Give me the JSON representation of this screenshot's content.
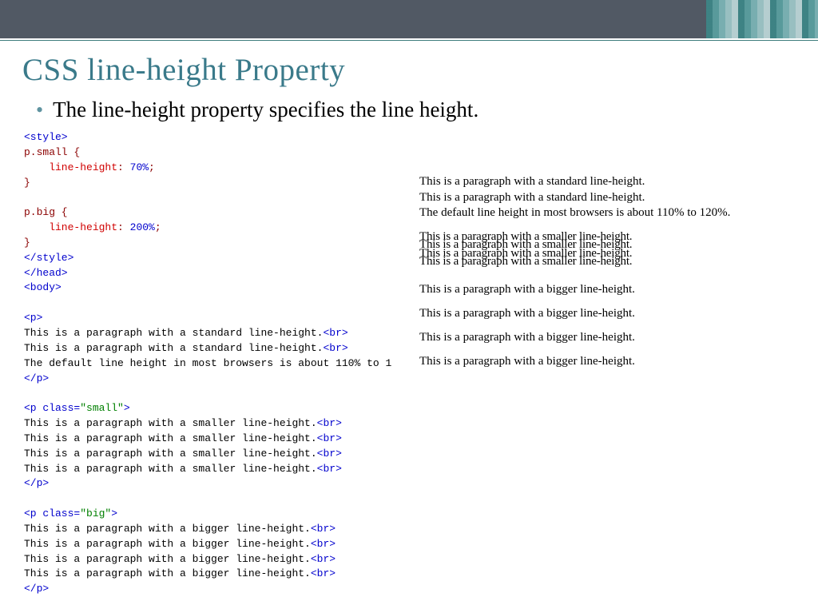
{
  "title": "CSS line-height Property",
  "bullet": "The line-height property specifies the line height.",
  "code": {
    "style_open": "<style>",
    "sel1": "p.small {",
    "prop1_name": "    line-height",
    "prop1_val": "70%",
    "sel1_close": "}",
    "sel2": "p.big {",
    "prop2_name": "    line-height",
    "prop2_val": "200%",
    "sel2_close": "}",
    "style_close": "</style>",
    "head_close": "</head>",
    "body_open": "<body>",
    "p_open": "<p>",
    "p_close": "</p>",
    "br": "<br>",
    "p_small": "<p class=",
    "attr_small": "\"small\"",
    "p_big": "<p class=",
    "attr_big": "\"big\"",
    "tag_end": ">",
    "std1": "This is a paragraph with a standard line-height.",
    "std2": "This is a paragraph with a standard line-height.",
    "std3": "The default line height in most browsers is about 110% to 1",
    "sm1": "This is a paragraph with a smaller line-height.",
    "sm2": "This is a paragraph with a smaller line-height.",
    "sm3": "This is a paragraph with a smaller line-height.",
    "sm4": "This is a paragraph with a smaller line-height.",
    "bg1": "This is a paragraph with a bigger line-height.",
    "bg2": "This is a paragraph with a bigger line-height.",
    "bg3": "This is a paragraph with a bigger line-height.",
    "bg4": "This is a paragraph with a bigger line-height."
  },
  "result": {
    "std1": "This is a paragraph with a standard line-height.",
    "std2": "This is a paragraph with a standard line-height.",
    "std3": "The default line height in most browsers is about 110% to 120%.",
    "sm1": "This is a paragraph with a smaller line-height.",
    "sm2": "This is a paragraph with a smaller line-height.",
    "sm3": "This is a paragraph with a smaller line-height.",
    "sm4": "This is a paragraph with a smaller line-height.",
    "bg1": "This is a paragraph with a bigger line-height.",
    "bg2": "This is a paragraph with a bigger line-height.",
    "bg3": "This is a paragraph with a bigger line-height.",
    "bg4": "This is a paragraph with a bigger line-height."
  }
}
